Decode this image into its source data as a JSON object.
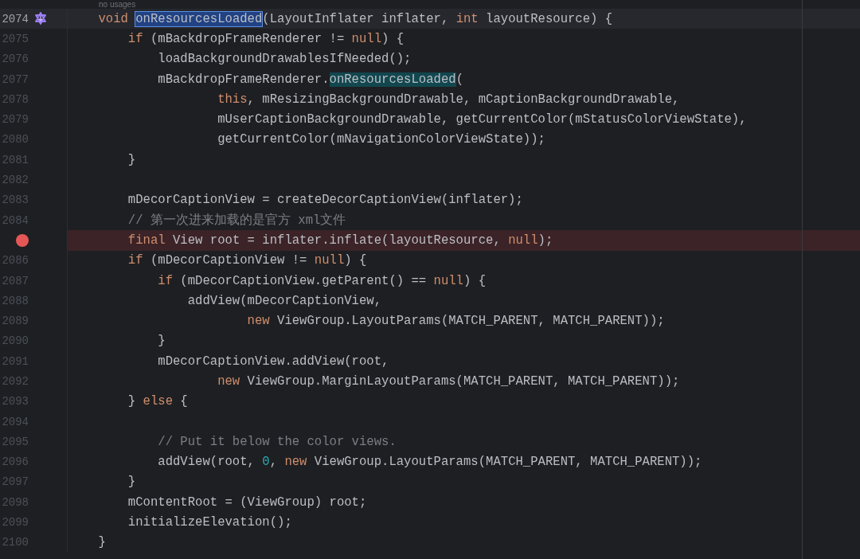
{
  "editor": {
    "hint": "no usages",
    "lines": [
      {
        "number": "2074",
        "current": true,
        "implemented": true,
        "segments": [
          {
            "text": "    void ",
            "kind": "keyword"
          },
          {
            "text": "onResourcesLoaded",
            "kind": "selected"
          },
          {
            "text": "(LayoutInflater inflater, ",
            "kind": "plain"
          },
          {
            "text": "int",
            "kind": "keyword"
          },
          {
            "text": " layoutResource) {",
            "kind": "plain"
          }
        ]
      },
      {
        "number": "2075",
        "segments": [
          {
            "text": "        if",
            "kind": "keyword"
          },
          {
            "text": " (mBackdropFrameRenderer != ",
            "kind": "plain"
          },
          {
            "text": "null",
            "kind": "keyword"
          },
          {
            "text": ") {",
            "kind": "plain"
          }
        ]
      },
      {
        "number": "2076",
        "segments": [
          {
            "text": "            loadBackgroundDrawablesIfNeeded();",
            "kind": "plain"
          }
        ]
      },
      {
        "number": "2077",
        "segments": [
          {
            "text": "            mBackdropFrameRenderer.",
            "kind": "plain"
          },
          {
            "text": "onResourcesLoaded",
            "kind": "usage"
          },
          {
            "text": "(",
            "kind": "plain"
          }
        ]
      },
      {
        "number": "2078",
        "segments": [
          {
            "text": "                    this",
            "kind": "keyword"
          },
          {
            "text": ", mResizingBackgroundDrawable, mCaptionBackgroundDrawable,",
            "kind": "plain"
          }
        ]
      },
      {
        "number": "2079",
        "segments": [
          {
            "text": "                    mUserCaptionBackgroundDrawable, getCurrentColor(mStatusColorViewState),",
            "kind": "plain"
          }
        ]
      },
      {
        "number": "2080",
        "segments": [
          {
            "text": "                    getCurrentColor(mNavigationColorViewState));",
            "kind": "plain"
          }
        ]
      },
      {
        "number": "2081",
        "segments": [
          {
            "text": "        }",
            "kind": "plain"
          }
        ]
      },
      {
        "number": "2082"
      },
      {
        "number": "2083",
        "segments": [
          {
            "text": "        mDecorCaptionView = createDecorCaptionView(inflater);",
            "kind": "plain"
          }
        ]
      },
      {
        "number": "2084",
        "segments": [
          {
            "text": "        // 第一次进来加载的是官方 xml文件",
            "kind": "comment"
          }
        ]
      },
      {
        "breakpoint": true,
        "segments": [
          {
            "text": "        final",
            "kind": "keyword"
          },
          {
            "text": " View root = inflater.inflate(layoutResource, ",
            "kind": "plain"
          },
          {
            "text": "null",
            "kind": "keyword"
          },
          {
            "text": ");",
            "kind": "plain"
          }
        ]
      },
      {
        "number": "2086",
        "segments": [
          {
            "text": "        if",
            "kind": "keyword"
          },
          {
            "text": " (mDecorCaptionView != ",
            "kind": "plain"
          },
          {
            "text": "null",
            "kind": "keyword"
          },
          {
            "text": ") {",
            "kind": "plain"
          }
        ]
      },
      {
        "number": "2087",
        "segments": [
          {
            "text": "            if",
            "kind": "keyword"
          },
          {
            "text": " (mDecorCaptionView.getParent() == ",
            "kind": "plain"
          },
          {
            "text": "null",
            "kind": "keyword"
          },
          {
            "text": ") {",
            "kind": "plain"
          }
        ]
      },
      {
        "number": "2088",
        "segments": [
          {
            "text": "                addView(mDecorCaptionView,",
            "kind": "plain"
          }
        ]
      },
      {
        "number": "2089",
        "segments": [
          {
            "text": "                        new",
            "kind": "keyword"
          },
          {
            "text": " ViewGroup.LayoutParams(MATCH_PARENT, MATCH_PARENT));",
            "kind": "plain"
          }
        ]
      },
      {
        "number": "2090",
        "segments": [
          {
            "text": "            }",
            "kind": "plain"
          }
        ]
      },
      {
        "number": "2091",
        "segments": [
          {
            "text": "            mDecorCaptionView.addView(root,",
            "kind": "plain"
          }
        ]
      },
      {
        "number": "2092",
        "segments": [
          {
            "text": "                    new",
            "kind": "keyword"
          },
          {
            "text": " ViewGroup.MarginLayoutParams(MATCH_PARENT, MATCH_PARENT));",
            "kind": "plain"
          }
        ]
      },
      {
        "number": "2093",
        "segments": [
          {
            "text": "        } ",
            "kind": "plain"
          },
          {
            "text": "else",
            "kind": "keyword"
          },
          {
            "text": " {",
            "kind": "plain"
          }
        ]
      },
      {
        "number": "2094"
      },
      {
        "number": "2095",
        "segments": [
          {
            "text": "            // Put it below the color views.",
            "kind": "comment"
          }
        ]
      },
      {
        "number": "2096",
        "segments": [
          {
            "text": "            addView(root, ",
            "kind": "plain"
          },
          {
            "text": "0",
            "kind": "number"
          },
          {
            "text": ", ",
            "kind": "plain"
          },
          {
            "text": "new",
            "kind": "keyword"
          },
          {
            "text": " ViewGroup.LayoutParams(MATCH_PARENT, MATCH_PARENT));",
            "kind": "plain"
          }
        ]
      },
      {
        "number": "2097",
        "segments": [
          {
            "text": "        }",
            "kind": "plain"
          }
        ]
      },
      {
        "number": "2098",
        "segments": [
          {
            "text": "        mContentRoot = (ViewGroup) root;",
            "kind": "plain"
          }
        ]
      },
      {
        "number": "2099",
        "segments": [
          {
            "text": "        initializeElevation();",
            "kind": "plain"
          }
        ]
      },
      {
        "number": "2100",
        "segments": [
          {
            "text": "    }",
            "kind": "plain"
          }
        ]
      }
    ]
  }
}
